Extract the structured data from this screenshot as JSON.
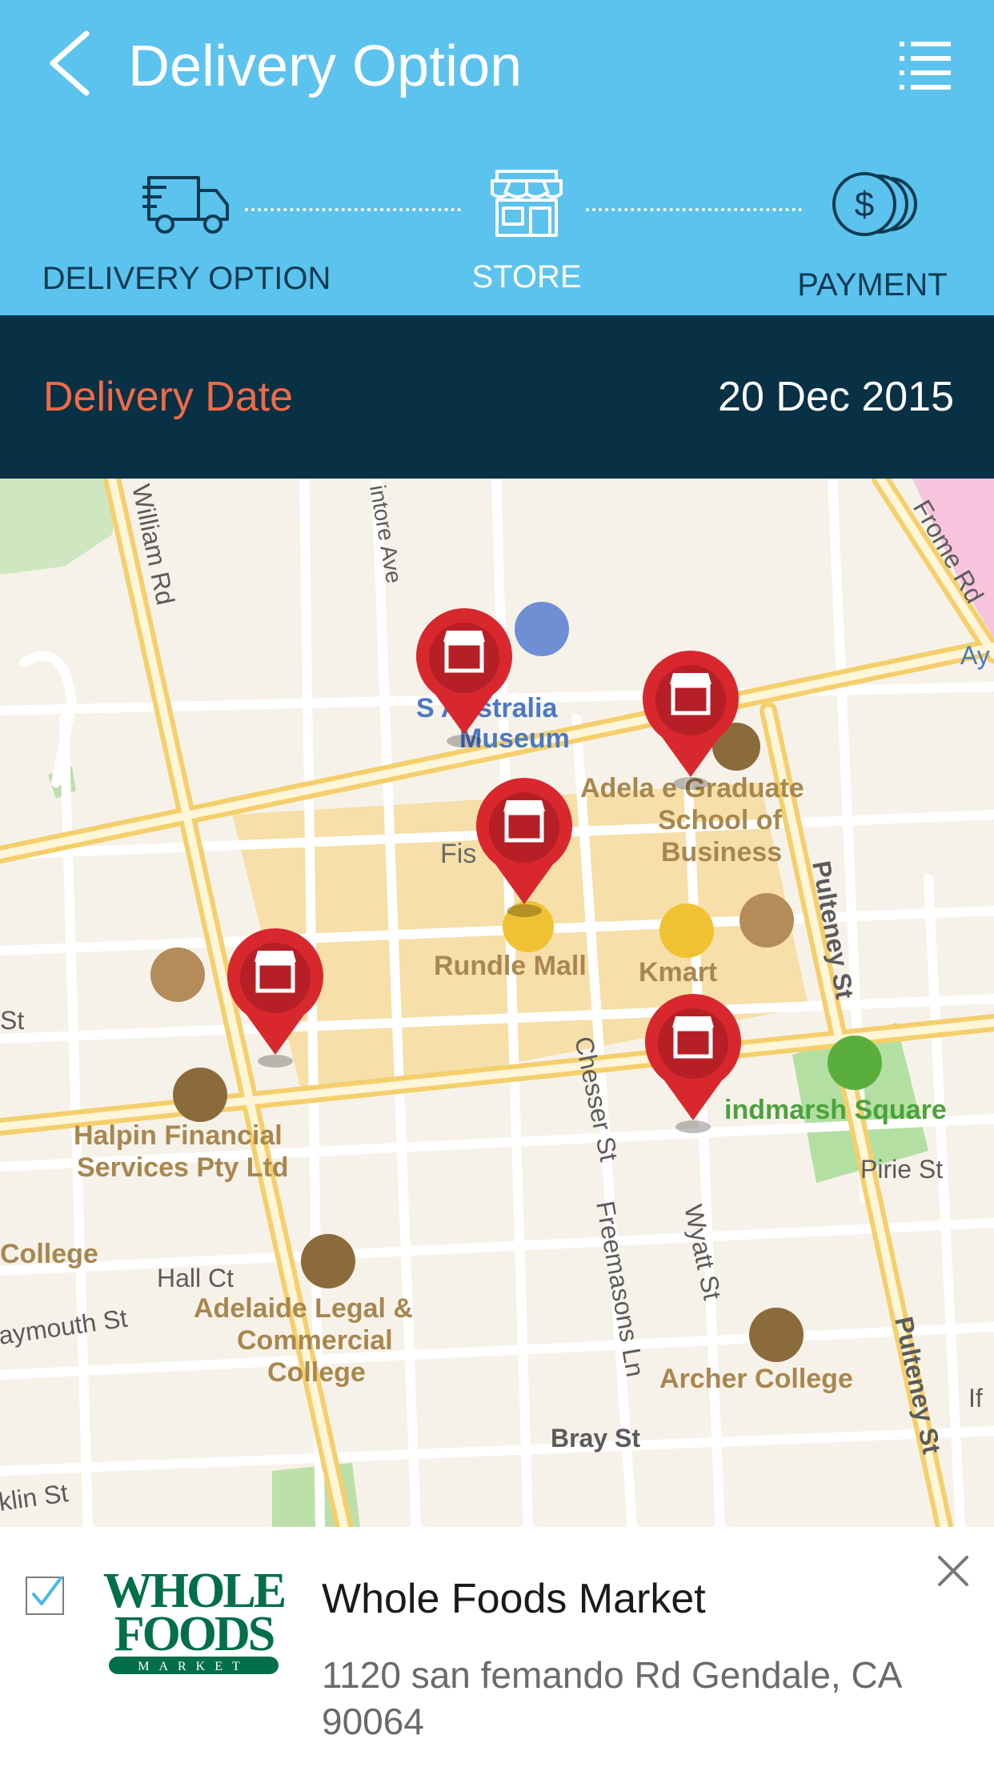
{
  "header": {
    "title": "Delivery Option",
    "back_icon": "chevron-left-icon",
    "menu_icon": "list-menu-icon"
  },
  "steps": [
    {
      "label": "DELIVERY OPTION",
      "icon": "delivery-truck-icon",
      "state": "done"
    },
    {
      "label": "STORE",
      "icon": "storefront-icon",
      "state": "current"
    },
    {
      "label": "PAYMENT",
      "icon": "coins-icon",
      "state": "upcoming"
    }
  ],
  "delivery": {
    "label": "Delivery Date",
    "value": "20 Dec 2015"
  },
  "map": {
    "street_labels": [
      "William Rd",
      "intore Ave",
      "Frome Rd",
      "Chesser St",
      "Pulteney St",
      "Freemasons Ln",
      "Wyatt St",
      "Bray St",
      "Hall Ct",
      "aymouth St",
      "klin St",
      "Pirie St",
      "St",
      "Ay",
      "If"
    ],
    "place_labels": [
      "S  Australia",
      "Museum",
      "Adela  e Graduate",
      "School of",
      "Business",
      "Fis",
      "Rundle Mall",
      "Kmart",
      "indmarsh Square",
      "Halpin Financial",
      "Services Pty Ltd",
      "College",
      "Adelaide Legal &",
      "Commercial",
      "College",
      "Archer College"
    ],
    "store_marker_icon": "store-pin-icon",
    "store_marker_count": 5
  },
  "store": {
    "name": "Whole Foods Market",
    "address": "1120 san femando Rd Gendale, CA 90064",
    "logo_lines": [
      "WHOLE",
      "FOODS",
      "MARKET"
    ],
    "selected": true,
    "close_icon": "close-icon"
  },
  "colors": {
    "header_bg": "#5bc3ee",
    "date_bar_bg": "#083145",
    "date_label": "#f26a45",
    "step_icon": "#0e3a52",
    "marker": "#d9272e",
    "logo_green": "#006f4a"
  }
}
